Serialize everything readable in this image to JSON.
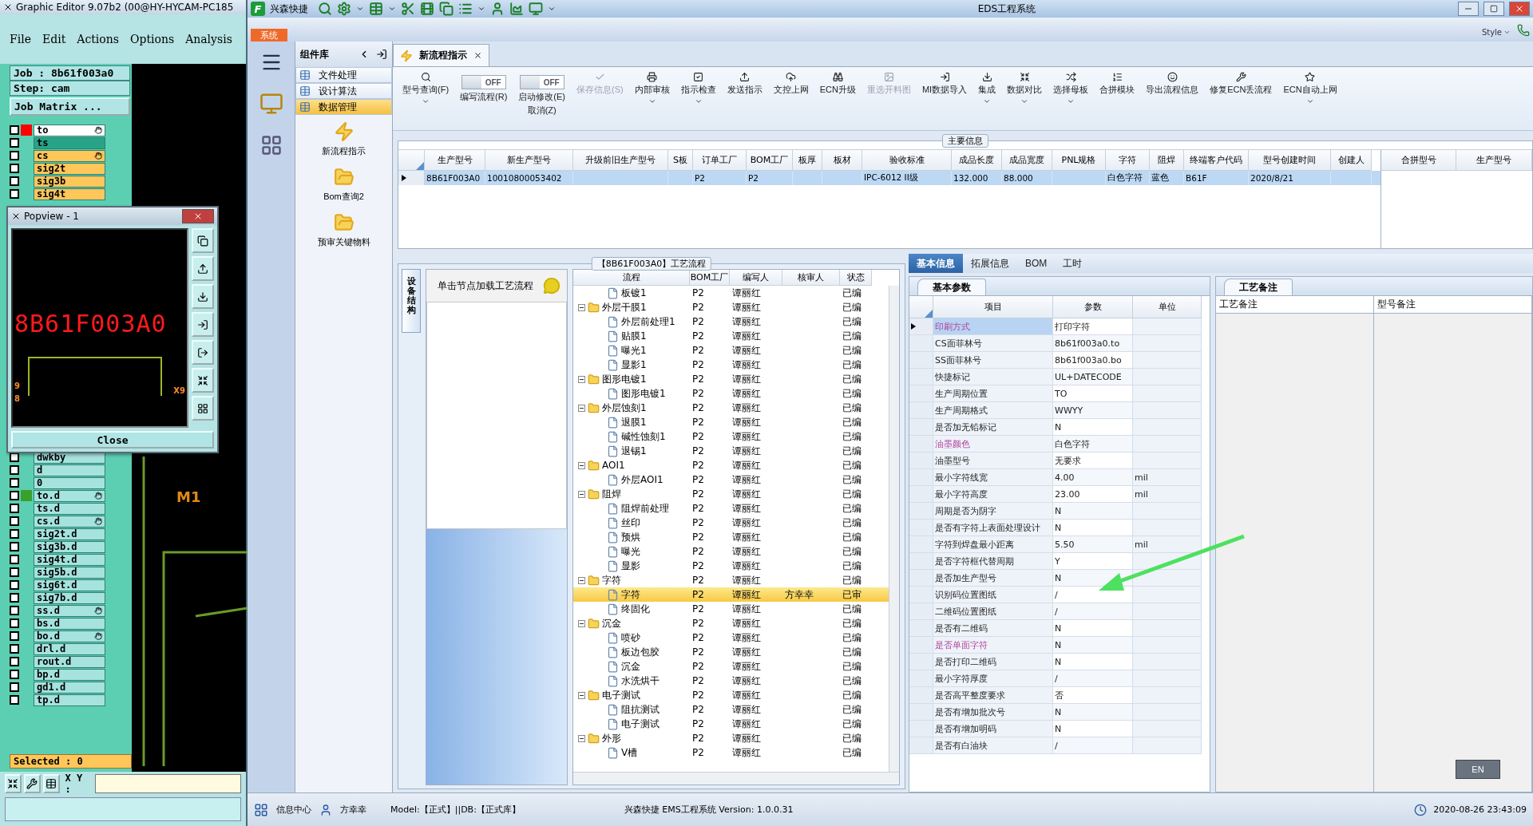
{
  "editor": {
    "title": "Graphic Editor 9.07b2 (00@HY-HYCAM-PC185",
    "menu": [
      "File",
      "Edit",
      "Actions",
      "Options",
      "Analysis"
    ],
    "job": "Job : 8b61f003a0",
    "step": "Step: cam",
    "matrix_button": "Job Matrix ...",
    "layers_top": [
      {
        "name": "to",
        "color": "#ffffff",
        "checked": false,
        "hand": true,
        "indicator": {
          "color": "#ff0000"
        }
      },
      {
        "name": "ts",
        "color": "#27a487",
        "checked": false,
        "hand": false
      },
      {
        "name": "cs",
        "color": "#ffc65a",
        "checked": false,
        "hand": true
      },
      {
        "name": "sig2t",
        "color": "#ffc65a",
        "checked": false,
        "hand": false
      },
      {
        "name": "sig3b",
        "color": "#ffc65a",
        "checked": false,
        "hand": false
      },
      {
        "name": "sig4t",
        "color": "#ffc65a",
        "checked": false,
        "hand": false
      }
    ],
    "layers_bottom": [
      {
        "name": "dwkby",
        "color": "#a6e2de",
        "checked": false,
        "hand": false
      },
      {
        "name": "d",
        "color": "#a6e2de",
        "checked": false,
        "hand": false
      },
      {
        "name": "0",
        "color": "#a6e2de",
        "checked": false,
        "hand": false
      },
      {
        "name": "to.d",
        "color": "#a6e2de",
        "checked": false,
        "hand": true,
        "indicator": {
          "color": "#3aa02c"
        }
      },
      {
        "name": "ts.d",
        "color": "#a6e2de",
        "checked": false,
        "hand": false
      },
      {
        "name": "cs.d",
        "color": "#a6e2de",
        "checked": false,
        "hand": true
      },
      {
        "name": "sig2t.d",
        "color": "#a6e2de",
        "checked": false,
        "hand": false
      },
      {
        "name": "sig3b.d",
        "color": "#a6e2de",
        "checked": false,
        "hand": false
      },
      {
        "name": "sig4t.d",
        "color": "#a6e2de",
        "checked": false,
        "hand": false
      },
      {
        "name": "sig5b.d",
        "color": "#a6e2de",
        "checked": false,
        "hand": false
      },
      {
        "name": "sig6t.d",
        "color": "#a6e2de",
        "checked": false,
        "hand": false
      },
      {
        "name": "sig7b.d",
        "color": "#a6e2de",
        "checked": false,
        "hand": false
      },
      {
        "name": "ss.d",
        "color": "#a6e2de",
        "checked": false,
        "hand": true
      },
      {
        "name": "bs.d",
        "color": "#a6e2de",
        "checked": false,
        "hand": false
      },
      {
        "name": "bo.d",
        "color": "#a6e2de",
        "checked": false,
        "hand": true
      },
      {
        "name": "drl.d",
        "color": "#a6e2de",
        "checked": false,
        "hand": false
      },
      {
        "name": "rout.d",
        "color": "#a6e2de",
        "checked": false,
        "hand": false
      },
      {
        "name": "bp.d",
        "color": "#a6e2de",
        "checked": false,
        "hand": false
      },
      {
        "name": "gd1.d",
        "color": "#a6e2de",
        "checked": false,
        "hand": false
      },
      {
        "name": "tp.d",
        "color": "#a6e2de",
        "checked": false,
        "hand": false
      }
    ],
    "selected_text": "Selected : 0",
    "xy_label": "X Y :",
    "canvas_label": "M1",
    "popview": {
      "title": "Popview - 1",
      "view_text": "8B61F003A0",
      "labels": [
        "9",
        "8",
        "X9"
      ],
      "close_button": "Close"
    }
  },
  "eds": {
    "title": "EDS工程系统",
    "brand": "兴森快捷",
    "logo": "F",
    "system_tab": "系统",
    "style_menu": "Style",
    "library": {
      "title": "组件库",
      "items": [
        {
          "label": "文件处理",
          "selected": false
        },
        {
          "label": "设计算法",
          "selected": false
        },
        {
          "label": "数据管理",
          "selected": true
        }
      ],
      "tools": [
        "新流程指示",
        "Bom查询2",
        "预审关键物料"
      ]
    },
    "doc_tab": {
      "label": "新流程指示",
      "selected": true
    },
    "ribbon": [
      {
        "kind": "button",
        "label": "型号查询(F)",
        "dropdown": true,
        "disabled": false
      },
      {
        "kind": "toggle",
        "label": "编写流程(R)",
        "switch_text": "OFF",
        "on": false
      },
      {
        "kind": "toggle",
        "label": "启动修改(E)",
        "sublabel": "取消(Z)",
        "switch_text": "OFF",
        "on": false
      },
      {
        "kind": "button",
        "label": "保存信息(S)",
        "dropdown": false,
        "disabled": true
      },
      {
        "kind": "button",
        "label": "内部审核",
        "dropdown": true,
        "disabled": false
      },
      {
        "kind": "button",
        "label": "指示检查",
        "dropdown": true,
        "disabled": false
      },
      {
        "kind": "button",
        "label": "发送指示",
        "dropdown": false,
        "disabled": false
      },
      {
        "kind": "button",
        "label": "文控上网",
        "dropdown": false,
        "disabled": false
      },
      {
        "kind": "button",
        "label": "ECN升级",
        "dropdown": false,
        "disabled": false
      },
      {
        "kind": "button",
        "label": "重选开料图",
        "dropdown": false,
        "disabled": true
      },
      {
        "kind": "button",
        "label": "MI数据导入",
        "dropdown": false,
        "disabled": false
      },
      {
        "kind": "button",
        "label": "集成",
        "dropdown": true,
        "disabled": false
      },
      {
        "kind": "button",
        "label": "数据对比",
        "dropdown": true,
        "disabled": false
      },
      {
        "kind": "button",
        "label": "选择母板",
        "dropdown": true,
        "disabled": false
      },
      {
        "kind": "button",
        "label": "合拼模块",
        "dropdown": false,
        "disabled": false
      },
      {
        "kind": "button",
        "label": "导出流程信息",
        "dropdown": false,
        "disabled": false
      },
      {
        "kind": "button",
        "label": "修复ECN丢流程",
        "dropdown": false,
        "disabled": false
      },
      {
        "kind": "button",
        "label": "ECN自动上网",
        "dropdown": true,
        "disabled": false
      }
    ],
    "main_info": {
      "title": "主要信息",
      "columns": [
        "生产型号",
        "新生产型号",
        "升级前旧生产型号",
        "S板",
        "订单工厂",
        "BOM工厂",
        "板厚",
        "板材",
        "验收标准",
        "成品长度",
        "成品宽度",
        "PNL规格",
        "字符",
        "阻焊",
        "终端客户代码",
        "型号创建时间",
        "创建人"
      ],
      "rows": [
        {
          "selected": true,
          "cells": [
            "8B61F003A0",
            "10010800053402",
            null,
            null,
            "P2",
            "P2",
            null,
            null,
            "IPC-6012 II级",
            "132.000",
            "88.000",
            null,
            "白色字符",
            "蓝色",
            "B61F",
            "2020/8/21",
            null
          ]
        }
      ],
      "side_columns": [
        "合拼型号",
        "生产型号"
      ]
    },
    "flow": {
      "title": "【8B61F003A0】工艺流程",
      "side_tab": "设备结构",
      "hint": "单击节点加载工艺流程",
      "columns": [
        "流程",
        "BOM工厂",
        "编写人",
        "核审人",
        "状态"
      ],
      "tree": [
        {
          "kind": "file",
          "name": "板镀1",
          "bom": "P2",
          "writer": "谭丽红",
          "status": "已编",
          "selected": false
        },
        {
          "kind": "folder",
          "name": "外层干膜1",
          "bom": "P2",
          "writer": "谭丽红",
          "status": "已编",
          "selected": false,
          "children": [
            {
              "kind": "file",
              "name": "外层前处理1",
              "bom": "P2",
              "writer": "谭丽红",
              "status": "已编",
              "selected": false
            },
            {
              "kind": "file",
              "name": "贴膜1",
              "bom": "P2",
              "writer": "谭丽红",
              "status": "已编",
              "selected": false
            },
            {
              "kind": "file",
              "name": "曝光1",
              "bom": "P2",
              "writer": "谭丽红",
              "status": "已编",
              "selected": false
            },
            {
              "kind": "file",
              "name": "显影1",
              "bom": "P2",
              "writer": "谭丽红",
              "status": "已编",
              "selected": false
            }
          ]
        },
        {
          "kind": "folder",
          "name": "图形电镀1",
          "bom": "P2",
          "writer": "谭丽红",
          "status": "已编",
          "selected": false,
          "children": [
            {
              "kind": "file",
              "name": "图形电镀1",
              "bom": "P2",
              "writer": "谭丽红",
              "status": "已编",
              "selected": false
            }
          ]
        },
        {
          "kind": "folder",
          "name": "外层蚀刻1",
          "bom": "P2",
          "writer": "谭丽红",
          "status": "已编",
          "selected": false,
          "children": [
            {
              "kind": "file",
              "name": "退膜1",
              "bom": "P2",
              "writer": "谭丽红",
              "status": "已编",
              "selected": false
            },
            {
              "kind": "file",
              "name": "碱性蚀刻1",
              "bom": "P2",
              "writer": "谭丽红",
              "status": "已编",
              "selected": false
            },
            {
              "kind": "file",
              "name": "退锡1",
              "bom": "P2",
              "writer": "谭丽红",
              "status": "已编",
              "selected": false
            }
          ]
        },
        {
          "kind": "folder",
          "name": "AOI1",
          "bom": "P2",
          "writer": "谭丽红",
          "status": "已编",
          "selected": false,
          "children": [
            {
              "kind": "file",
              "name": "外层AOI1",
              "bom": "P2",
              "writer": "谭丽红",
              "status": "已编",
              "selected": false
            }
          ]
        },
        {
          "kind": "folder",
          "name": "阻焊",
          "bom": "P2",
          "writer": "谭丽红",
          "status": "已编",
          "selected": false,
          "children": [
            {
              "kind": "file",
              "name": "阻焊前处理",
              "bom": "P2",
              "writer": "谭丽红",
              "status": "已编",
              "selected": false
            },
            {
              "kind": "file",
              "name": "丝印",
              "bom": "P2",
              "writer": "谭丽红",
              "status": "已编",
              "selected": false
            },
            {
              "kind": "file",
              "name": "预烘",
              "bom": "P2",
              "writer": "谭丽红",
              "status": "已编",
              "selected": false
            },
            {
              "kind": "file",
              "name": "曝光",
              "bom": "P2",
              "writer": "谭丽红",
              "status": "已编",
              "selected": false
            },
            {
              "kind": "file",
              "name": "显影",
              "bom": "P2",
              "writer": "谭丽红",
              "status": "已编",
              "selected": false
            }
          ]
        },
        {
          "kind": "folder",
          "name": "字符",
          "bom": "P2",
          "writer": "谭丽红",
          "status": "已编",
          "selected": false,
          "children": [
            {
              "kind": "file",
              "name": "字符",
              "bom": "P2",
              "writer": "谭丽红",
              "reviewer": "方幸幸",
              "status": "已审",
              "selected": true
            },
            {
              "kind": "file",
              "name": "终固化",
              "bom": "P2",
              "writer": "谭丽红",
              "status": "已编",
              "selected": false
            }
          ]
        },
        {
          "kind": "folder",
          "name": "沉金",
          "bom": "P2",
          "writer": "谭丽红",
          "status": "已编",
          "selected": false,
          "children": [
            {
              "kind": "file",
              "name": "喷砂",
              "bom": "P2",
              "writer": "谭丽红",
              "status": "已编",
              "selected": false
            },
            {
              "kind": "file",
              "name": "板边包胶",
              "bom": "P2",
              "writer": "谭丽红",
              "status": "已编",
              "selected": false
            },
            {
              "kind": "file",
              "name": "沉金",
              "bom": "P2",
              "writer": "谭丽红",
              "status": "已编",
              "selected": false
            },
            {
              "kind": "file",
              "name": "水洗烘干",
              "bom": "P2",
              "writer": "谭丽红",
              "status": "已编",
              "selected": false
            }
          ]
        },
        {
          "kind": "folder",
          "name": "电子测试",
          "bom": "P2",
          "writer": "谭丽红",
          "status": "已编",
          "selected": false,
          "children": [
            {
              "kind": "file",
              "name": "阻抗测试",
              "bom": "P2",
              "writer": "谭丽红",
              "status": "已编",
              "selected": false
            },
            {
              "kind": "file",
              "name": "电子测试",
              "bom": "P2",
              "writer": "谭丽红",
              "status": "已编",
              "selected": false
            }
          ]
        },
        {
          "kind": "folder",
          "name": "外形",
          "bom": "P2",
          "writer": "谭丽红",
          "status": "已编",
          "selected": false,
          "children": [
            {
              "kind": "file",
              "name": "V槽",
              "bom": "P2",
              "writer": "谭丽红",
              "status": "已编",
              "selected": false
            }
          ]
        }
      ]
    },
    "info_tabs": [
      {
        "label": "基本信息",
        "selected": true
      },
      {
        "label": "拓展信息",
        "selected": false
      },
      {
        "label": "BOM",
        "selected": false
      },
      {
        "label": "工时",
        "selected": false
      }
    ],
    "params": {
      "tab": "基本参数",
      "columns": [
        "项目",
        "参数",
        "单位"
      ],
      "rows": [
        {
          "item": "印刷方式",
          "value": "打印字符",
          "highlight": true,
          "selected": true
        },
        {
          "item": "CS面菲林号",
          "value": "8b61f003a0.to",
          "highlight": false,
          "selected": false
        },
        {
          "item": "SS面菲林号",
          "value": "8b61f003a0.bo",
          "highlight": false,
          "selected": false
        },
        {
          "item": "快捷标记",
          "value": "UL+DATECODE",
          "highlight": false,
          "selected": false
        },
        {
          "item": "生产周期位置",
          "value": "TO",
          "highlight": false,
          "selected": false
        },
        {
          "item": "生产周期格式",
          "value": "WWYY",
          "highlight": false,
          "selected": false
        },
        {
          "item": "是否加无铅标记",
          "value": "N",
          "highlight": false,
          "selected": false
        },
        {
          "item": "油墨颜色",
          "value": "白色字符",
          "highlight": true,
          "selected": false
        },
        {
          "item": "油墨型号",
          "value": "无要求",
          "highlight": false,
          "selected": false
        },
        {
          "item": "最小字符线宽",
          "value": "4.00",
          "unit": "mil",
          "highlight": false,
          "selected": false
        },
        {
          "item": "最小字符高度",
          "value": "23.00",
          "unit": "mil",
          "highlight": false,
          "selected": false
        },
        {
          "item": "周期是否为阴字",
          "value": "N",
          "highlight": false,
          "selected": false
        },
        {
          "item": "是否有字符上表面处理设计",
          "value": "N",
          "highlight": false,
          "selected": false
        },
        {
          "item": "字符到焊盘最小距离",
          "value": "5.50",
          "unit": "mil",
          "highlight": false,
          "selected": false
        },
        {
          "item": "是否字符框代替周期",
          "value": "Y",
          "highlight": false,
          "selected": false
        },
        {
          "item": "是否加生产型号",
          "value": "N",
          "highlight": false,
          "selected": false
        },
        {
          "item": "识别码位置图纸",
          "value": "/",
          "highlight": false,
          "selected": false
        },
        {
          "item": "二维码位置图纸",
          "value": "/",
          "highlight": false,
          "selected": false
        },
        {
          "item": "是否有二维码",
          "value": "N",
          "highlight": false,
          "selected": false
        },
        {
          "item": "是否单面字符",
          "value": "N",
          "highlight": true,
          "selected": false
        },
        {
          "item": "是否打印二维码",
          "value": "N",
          "highlight": false,
          "selected": false
        },
        {
          "item": "最小字符厚度",
          "value": "/",
          "highlight": false,
          "selected": false
        },
        {
          "item": "是否高平整度要求",
          "value": "否",
          "highlight": false,
          "selected": false
        },
        {
          "item": "是否有增加批次号",
          "value": "N",
          "highlight": false,
          "selected": false
        },
        {
          "item": "是否有增加明码",
          "value": "N",
          "highlight": false,
          "selected": false
        },
        {
          "item": "是否有白油块",
          "value": "/",
          "highlight": false,
          "selected": false
        }
      ]
    },
    "notes": {
      "tab": "工艺备注",
      "columns": [
        "工艺备注",
        "型号备注"
      ]
    },
    "ime": "EN",
    "status_bar": {
      "info_center": "信息中心",
      "user": "方幸幸",
      "env": "Model:【正式】||DB:【正式库】",
      "version": "兴森快捷 EMS工程系统 Version: 1.0.0.31",
      "datetime": "2020-08-26 23:43:09"
    }
  }
}
